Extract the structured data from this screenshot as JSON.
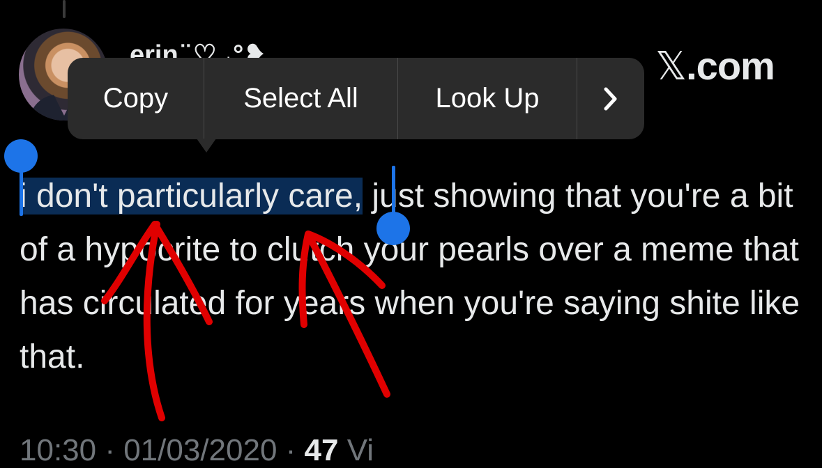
{
  "header": {
    "username": "erin ̈ ♡ ˖°❥",
    "site": "X.com"
  },
  "context_menu": {
    "items": [
      "Copy",
      "Select All",
      "Look Up"
    ],
    "more_icon": "chevron-right-icon"
  },
  "tweet": {
    "selected_text": "i don't particularly care,",
    "rest_text": " just showing that you're a bit of a hypocrite to clutch your pearls over a meme that has circulated for years when you're saying shite like that."
  },
  "footer": {
    "time": "10:30 · 01/03/2020 · ",
    "views_count": "47",
    "views_label": " Vi"
  },
  "colors": {
    "background": "#000000",
    "text": "#e7e9ea",
    "selection": "#0a2c55",
    "handle": "#1d74e8",
    "annotation": "#e00000"
  }
}
